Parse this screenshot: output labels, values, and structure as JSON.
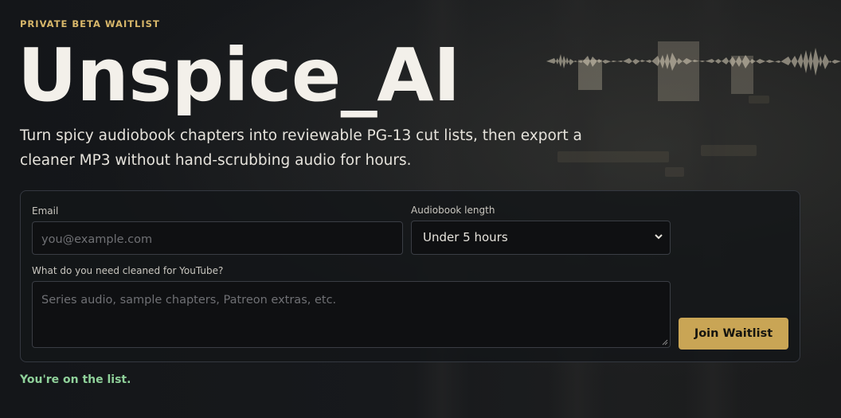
{
  "header": {
    "eyebrow": "PRIVATE BETA WAITLIST",
    "title": "Unspice_AI",
    "subtitle": "Turn spicy audiobook chapters into reviewable PG-13 cut lists, then export a cleaner MP3 without hand-scrubbing audio for hours."
  },
  "form": {
    "email": {
      "label": "Email",
      "placeholder": "you@example.com",
      "value": ""
    },
    "length": {
      "label": "Audiobook length",
      "selected": "Under 5 hours"
    },
    "needs": {
      "label": "What do you need cleaned for YouTube?",
      "placeholder": "Series audio, sample chapters, Patreon extras, etc.",
      "value": ""
    },
    "submit_label": "Join Waitlist"
  },
  "status": {
    "message": "You're on the list."
  },
  "colors": {
    "accent": "#c9a555",
    "eyebrow": "#d8b76a",
    "success": "#8fd19a",
    "background": "#15171a"
  },
  "icons": {
    "select": "chevron-down-icon",
    "textarea": "resize-grip-icon"
  }
}
